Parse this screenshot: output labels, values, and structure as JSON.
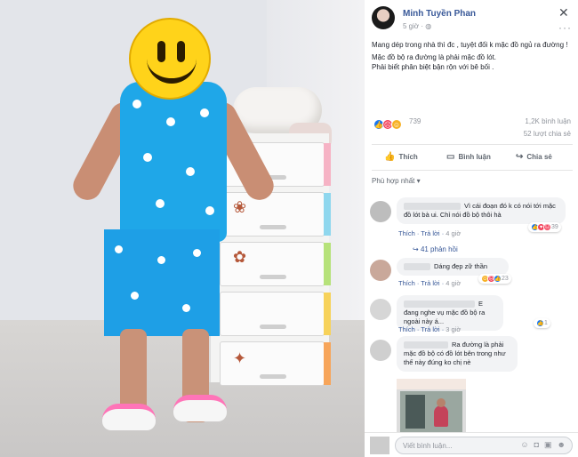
{
  "post": {
    "author": "Minh Tuyền Phan",
    "time": "5 giờ",
    "privacy_icon": "globe-icon",
    "lines": [
      "Mang dép trong nhà thì đc , tuyệt đối k mặc đồ ngủ ra đường !",
      "Mặc đồ bộ ra đường là phải mặc đồ lót.",
      "Phải biết phân biệt bận rộn với bê bối ."
    ],
    "reaction_count": "739",
    "comment_count": "1,2K bình luận",
    "share_count": "52 lượt chia sẻ"
  },
  "actions": {
    "like": "Thích",
    "comment": "Bình luận",
    "share": "Chia sẻ"
  },
  "sort_label": "Phù hợp nhất",
  "comments": [
    {
      "text": "Vì cái đoạn đó k có nói tới mặc đồ lót bà ui. Chỉ nói đồ bộ thôi hà",
      "like": "Thích",
      "reply": "Trả lời",
      "time": "4 giờ",
      "reactions": "39"
    },
    {
      "text": "Dáng đẹp zữ thần",
      "like": "Thích",
      "reply": "Trả lời",
      "time": "4 giờ",
      "reactions": "23"
    },
    {
      "text": "E đang nghe vụ mặc đồ bộ ra ngoài này á...",
      "like": "Thích",
      "reply": "Trả lời",
      "time": "3 giờ",
      "reactions": "1"
    },
    {
      "text": "Ra đường là phải mặc đồ bộ có đồ lót bên trong như thế này đúng ko chị nè"
    }
  ],
  "replies_link": "41 phản hồi",
  "input_placeholder": "Viết bình luận...",
  "colors": {
    "link": "#385898",
    "like": "#1877f2",
    "love": "#f33e58",
    "haha": "#f7b125"
  }
}
